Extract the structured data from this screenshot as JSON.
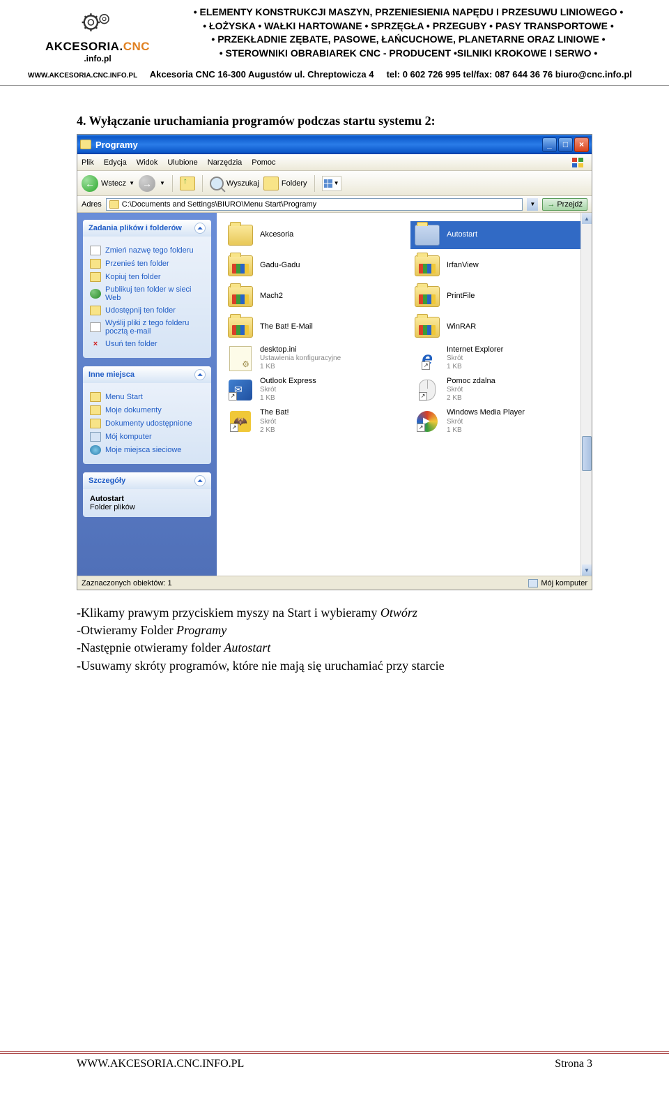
{
  "header": {
    "logo_main": "AKCESORIA.",
    "logo_cnc": "CNC",
    "logo_sub": ".info.pl",
    "line1": "• ELEMENTY KONSTRUKCJI MASZYN, PRZENIESIENIA NAPĘDU I PRZESUWU LINIOWEGO •",
    "line2": "• ŁOŻYSKA • WAŁKI HARTOWANE • SPRZĘGŁA • PRZEGUBY • PASY TRANSPORTOWE •",
    "line3": "• PRZEKŁADNIE ZĘBATE, PASOWE, ŁAŃCUCHOWE, PLANETARNE ORAZ LINIOWE •",
    "line4": "• STEROWNIKI OBRABIAREK CNC - PRODUCENT •SILNIKI KROKOWE I SERWO •",
    "contact_left": "WWW.AKCESORIA.CNC.INFO.PL",
    "contact_mid": "Akcesoria CNC  16-300 Augustów  ul. Chreptowicza 4",
    "contact_tel": "tel: 0 602 726 995 tel/fax: 087 644 36 76  biuro@cnc.info.pl"
  },
  "section_title": "4.  Wyłączanie uruchamiania programów podczas startu systemu 2:",
  "instructions": {
    "l1a": "-Klikamy prawym przyciskiem myszy na Start i wybieramy ",
    "l1b": "Otwórz",
    "l2a": "-Otwieramy Folder ",
    "l2b": "Programy",
    "l3a": "-Następnie otwieramy folder ",
    "l3b": "Autostart",
    "l4": "-Usuwamy skróty programów, które nie mają się uruchamiać przy starcie"
  },
  "screenshot": {
    "title": "Programy",
    "menu": {
      "file": "Plik",
      "edit": "Edycja",
      "view": "Widok",
      "fav": "Ulubione",
      "tools": "Narzędzia",
      "help": "Pomoc"
    },
    "toolbar": {
      "back": "Wstecz",
      "search": "Wyszukaj",
      "folders": "Foldery"
    },
    "address_label": "Adres",
    "address_path": "C:\\Documents and Settings\\BIURO\\Menu Start\\Programy",
    "go": "Przejdź",
    "sidebar": {
      "panel1_title": "Zadania plików i folderów",
      "panel1_items": [
        "Zmień nazwę tego folderu",
        "Przenieś ten folder",
        "Kopiuj ten folder",
        "Publikuj ten folder w sieci Web",
        "Udostępnij ten folder",
        "Wyślij pliki z tego folderu pocztą e-mail",
        "Usuń ten folder"
      ],
      "panel2_title": "Inne miejsca",
      "panel2_items": [
        "Menu Start",
        "Moje dokumenty",
        "Dokumenty udostępnione",
        "Mój komputer",
        "Moje miejsca sieciowe"
      ],
      "panel3_title": "Szczegóły",
      "panel3_name": "Autostart",
      "panel3_type": "Folder plików"
    },
    "files": {
      "col1": [
        {
          "name": "Akcesoria",
          "type": "folder"
        },
        {
          "name": "Gadu-Gadu",
          "type": "folder-items"
        },
        {
          "name": "Mach2",
          "type": "folder-items"
        },
        {
          "name": "The Bat! E-Mail",
          "type": "folder-items"
        },
        {
          "name": "desktop.ini",
          "sub1": "Ustawienia konfiguracyjne",
          "sub2": "1 KB",
          "type": "ini"
        },
        {
          "name": "Outlook Express",
          "sub1": "Skrót",
          "sub2": "1 KB",
          "type": "outlook"
        },
        {
          "name": "The Bat!",
          "sub1": "Skrót",
          "sub2": "2 KB",
          "type": "bat"
        }
      ],
      "col2": [
        {
          "name": "Autostart",
          "type": "folder-open",
          "selected": true
        },
        {
          "name": "IrfanView",
          "type": "folder-items"
        },
        {
          "name": "PrintFile",
          "type": "folder-items"
        },
        {
          "name": "WinRAR",
          "type": "folder-items"
        },
        {
          "name": "Internet Explorer",
          "sub1": "Skrót",
          "sub2": "1 KB",
          "type": "ie"
        },
        {
          "name": "Pomoc zdalna",
          "sub1": "Skrót",
          "sub2": "2 KB",
          "type": "mouse"
        },
        {
          "name": "Windows Media Player",
          "sub1": "Skrót",
          "sub2": "1 KB",
          "type": "wmp"
        }
      ]
    },
    "statusbar": {
      "left": "Zaznaczonych obiektów: 1",
      "right": "Mój komputer"
    }
  },
  "footer": {
    "left": "WWW.AKCESORIA.CNC.INFO.PL",
    "right": "Strona 3"
  }
}
